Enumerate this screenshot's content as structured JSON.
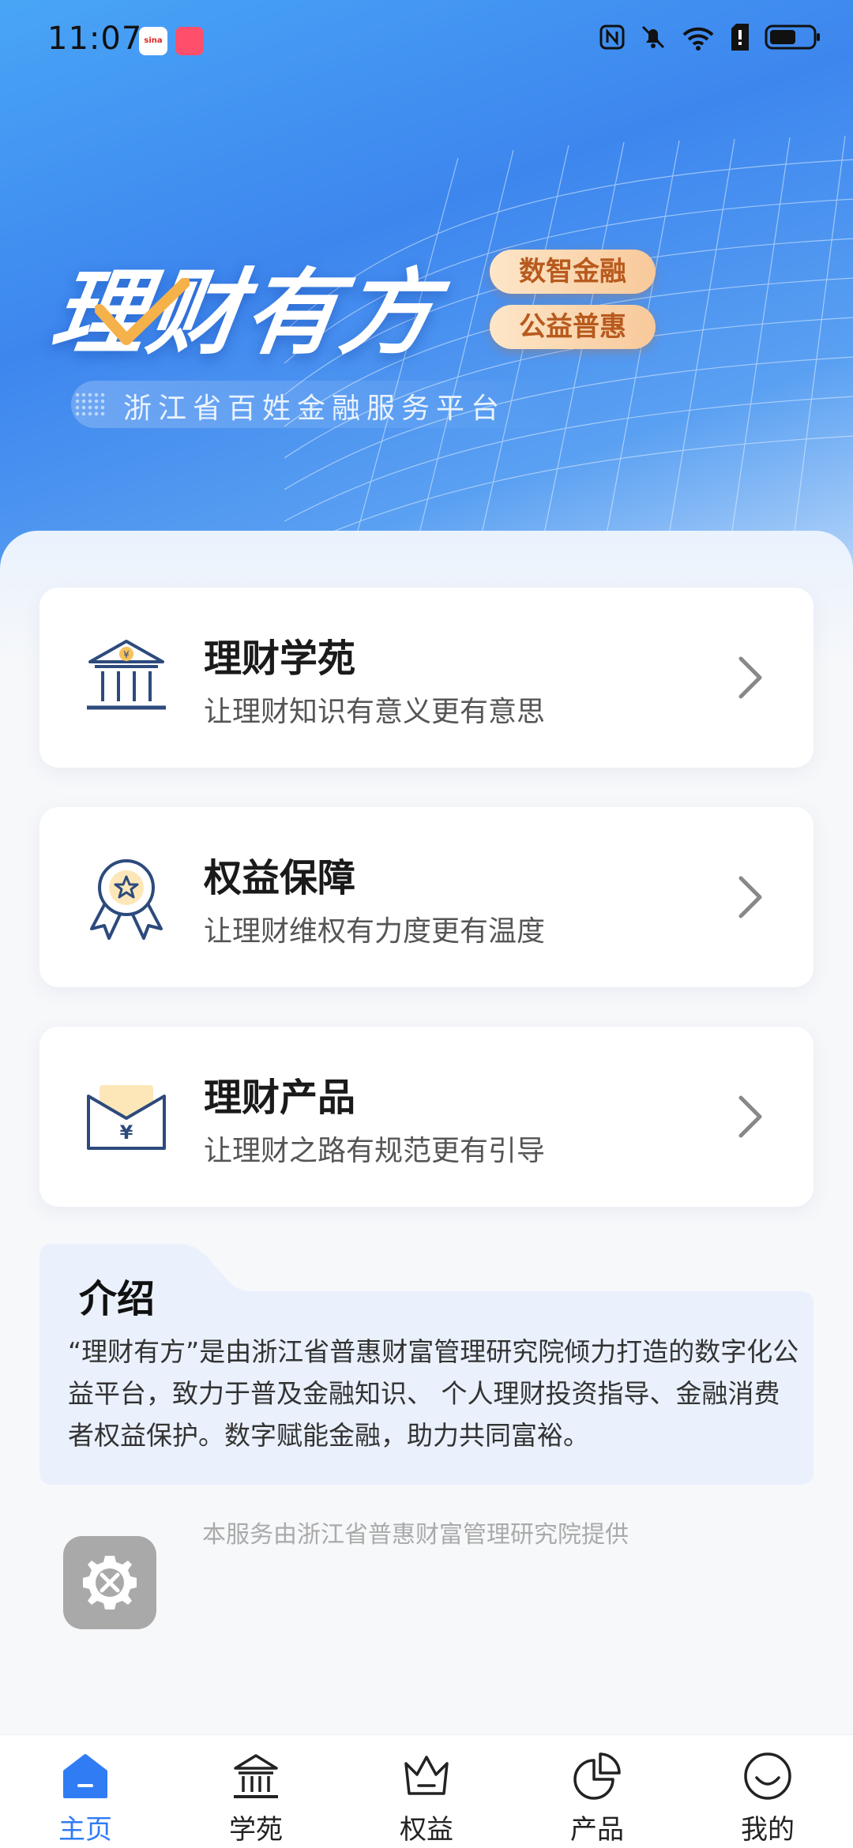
{
  "status_bar": {
    "time": "11:07",
    "app1": "sina",
    "app2": "",
    "icons": [
      "nfc-icon",
      "mute-icon",
      "wifi-icon",
      "sim-icon",
      "battery-icon"
    ]
  },
  "hero": {
    "title": "理财有方",
    "badges": [
      "数智金融",
      "公益普惠"
    ],
    "tagline": "浙江省百姓金融服务平台"
  },
  "cards": [
    {
      "title": "理财学苑",
      "subtitle": "让理财知识有意义更有意思",
      "icon": "bank-icon"
    },
    {
      "title": "权益保障",
      "subtitle": "让理财维权有力度更有温度",
      "icon": "medal-icon"
    },
    {
      "title": "理财产品",
      "subtitle": "让理财之路有规范更有引导",
      "icon": "envelope-icon"
    }
  ],
  "intro": {
    "title": "介绍",
    "text": "“理财有方”是由浙江省普惠财富管理研究院倾力打造的数字化公益平台，致力于普及金融知识、 个人理财投资指导、金融消费者权益保护。数字赋能金融，助力共同富裕。"
  },
  "footer_note": "本服务由浙江省普惠财富管理研究院提供",
  "tabs": [
    {
      "label": "主页",
      "active": true
    },
    {
      "label": "学苑",
      "active": false
    },
    {
      "label": "权益",
      "active": false
    },
    {
      "label": "产品",
      "active": false
    },
    {
      "label": "我的",
      "active": false
    }
  ],
  "colors": {
    "accent": "#2f7cf5",
    "badge_text": "#b85a1e",
    "icon_navy": "#2d4a7c"
  }
}
